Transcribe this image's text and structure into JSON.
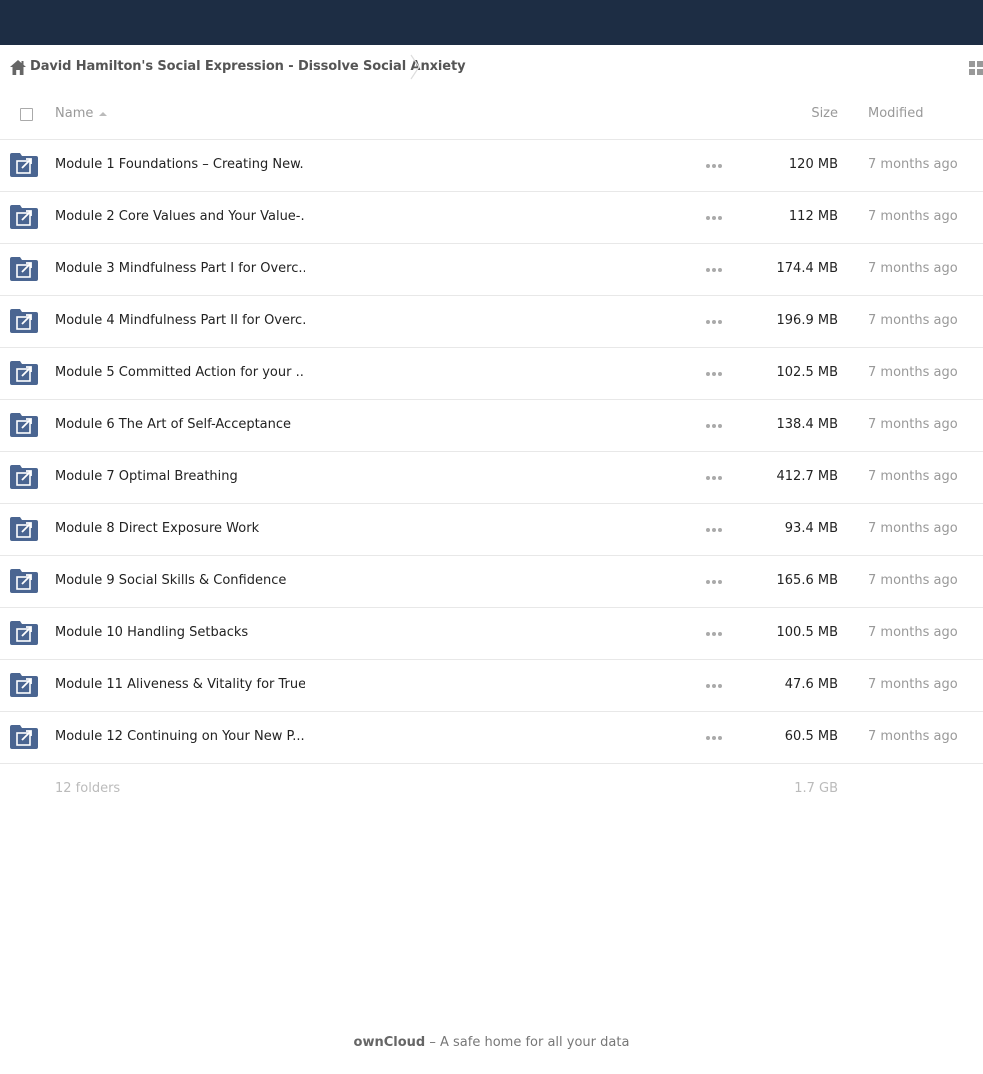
{
  "breadcrumb": {
    "home_icon": "home-icon",
    "current_folder": "David Hamilton's Social Expression - Dissolve Social Anxiety"
  },
  "view_toggle_icon": "grid-view-icon",
  "table_header": {
    "name": "Name",
    "size": "Size",
    "modified": "Modified"
  },
  "files": [
    {
      "name": "Module 1 Foundations – Creating New...",
      "size": "120 MB",
      "modified": "7 months ago"
    },
    {
      "name": "Module 2 Core Values and Your Value-...",
      "size": "112 MB",
      "modified": "7 months ago"
    },
    {
      "name": "Module 3 Mindfulness Part I for Overc...",
      "size": "174.4 MB",
      "modified": "7 months ago"
    },
    {
      "name": "Module 4 Mindfulness Part II for Overc...",
      "size": "196.9 MB",
      "modified": "7 months ago"
    },
    {
      "name": "Module 5 Committed Action for your ...",
      "size": "102.5 MB",
      "modified": "7 months ago"
    },
    {
      "name": "Module 6 The Art of Self-Acceptance",
      "size": "138.4 MB",
      "modified": "7 months ago"
    },
    {
      "name": "Module 7 Optimal Breathing",
      "size": "412.7 MB",
      "modified": "7 months ago"
    },
    {
      "name": "Module 8 Direct Exposure Work",
      "size": "93.4 MB",
      "modified": "7 months ago"
    },
    {
      "name": "Module 9 Social Skills & Confidence",
      "size": "165.6 MB",
      "modified": "7 months ago"
    },
    {
      "name": "Module 10 Handling Setbacks",
      "size": "100.5 MB",
      "modified": "7 months ago"
    },
    {
      "name": "Module 11 Aliveness & Vitality for True...",
      "size": "47.6 MB",
      "modified": "7 months ago"
    },
    {
      "name": "Module 12 Continuing on Your New P...",
      "size": "60.5 MB",
      "modified": "7 months ago"
    }
  ],
  "summary": {
    "count": "12 folders",
    "total_size": "1.7 GB"
  },
  "footer": {
    "brand": "ownCloud",
    "tagline": " – A safe home for all your data"
  },
  "colors": {
    "topbar": "#1d2d44",
    "folder": "#4a6591"
  }
}
